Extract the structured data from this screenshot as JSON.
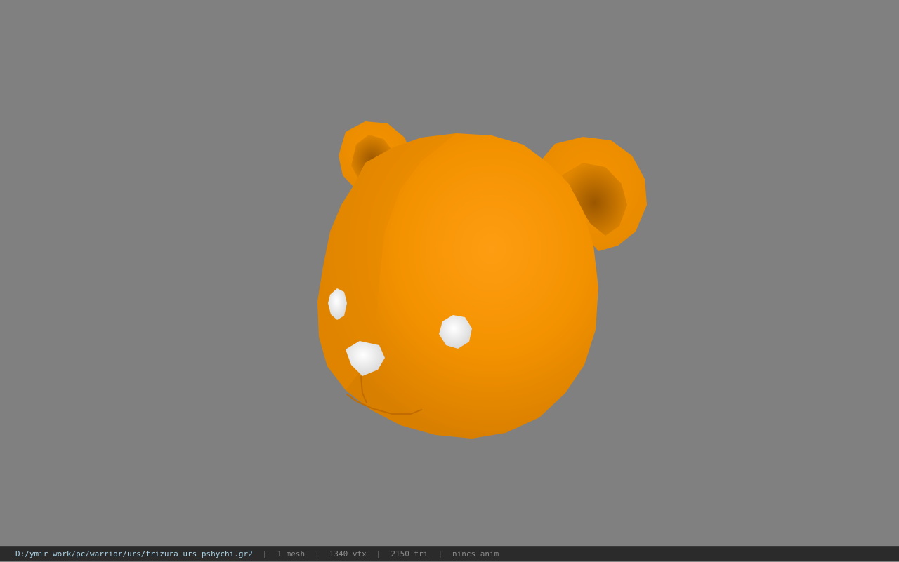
{
  "viewer": {
    "background_color": "#808080",
    "model_color": "#f39200",
    "model_label": "bear-head-model"
  },
  "status_bar": {
    "file_path": "D:/ymir work/pc/warrior/urs/frizura_urs_pshychi.gr2",
    "separator": "|",
    "mesh_count": "1 mesh",
    "vertex_count": "1340 vtx",
    "triangle_count": "2150 tri",
    "animation": "nincs anim"
  }
}
